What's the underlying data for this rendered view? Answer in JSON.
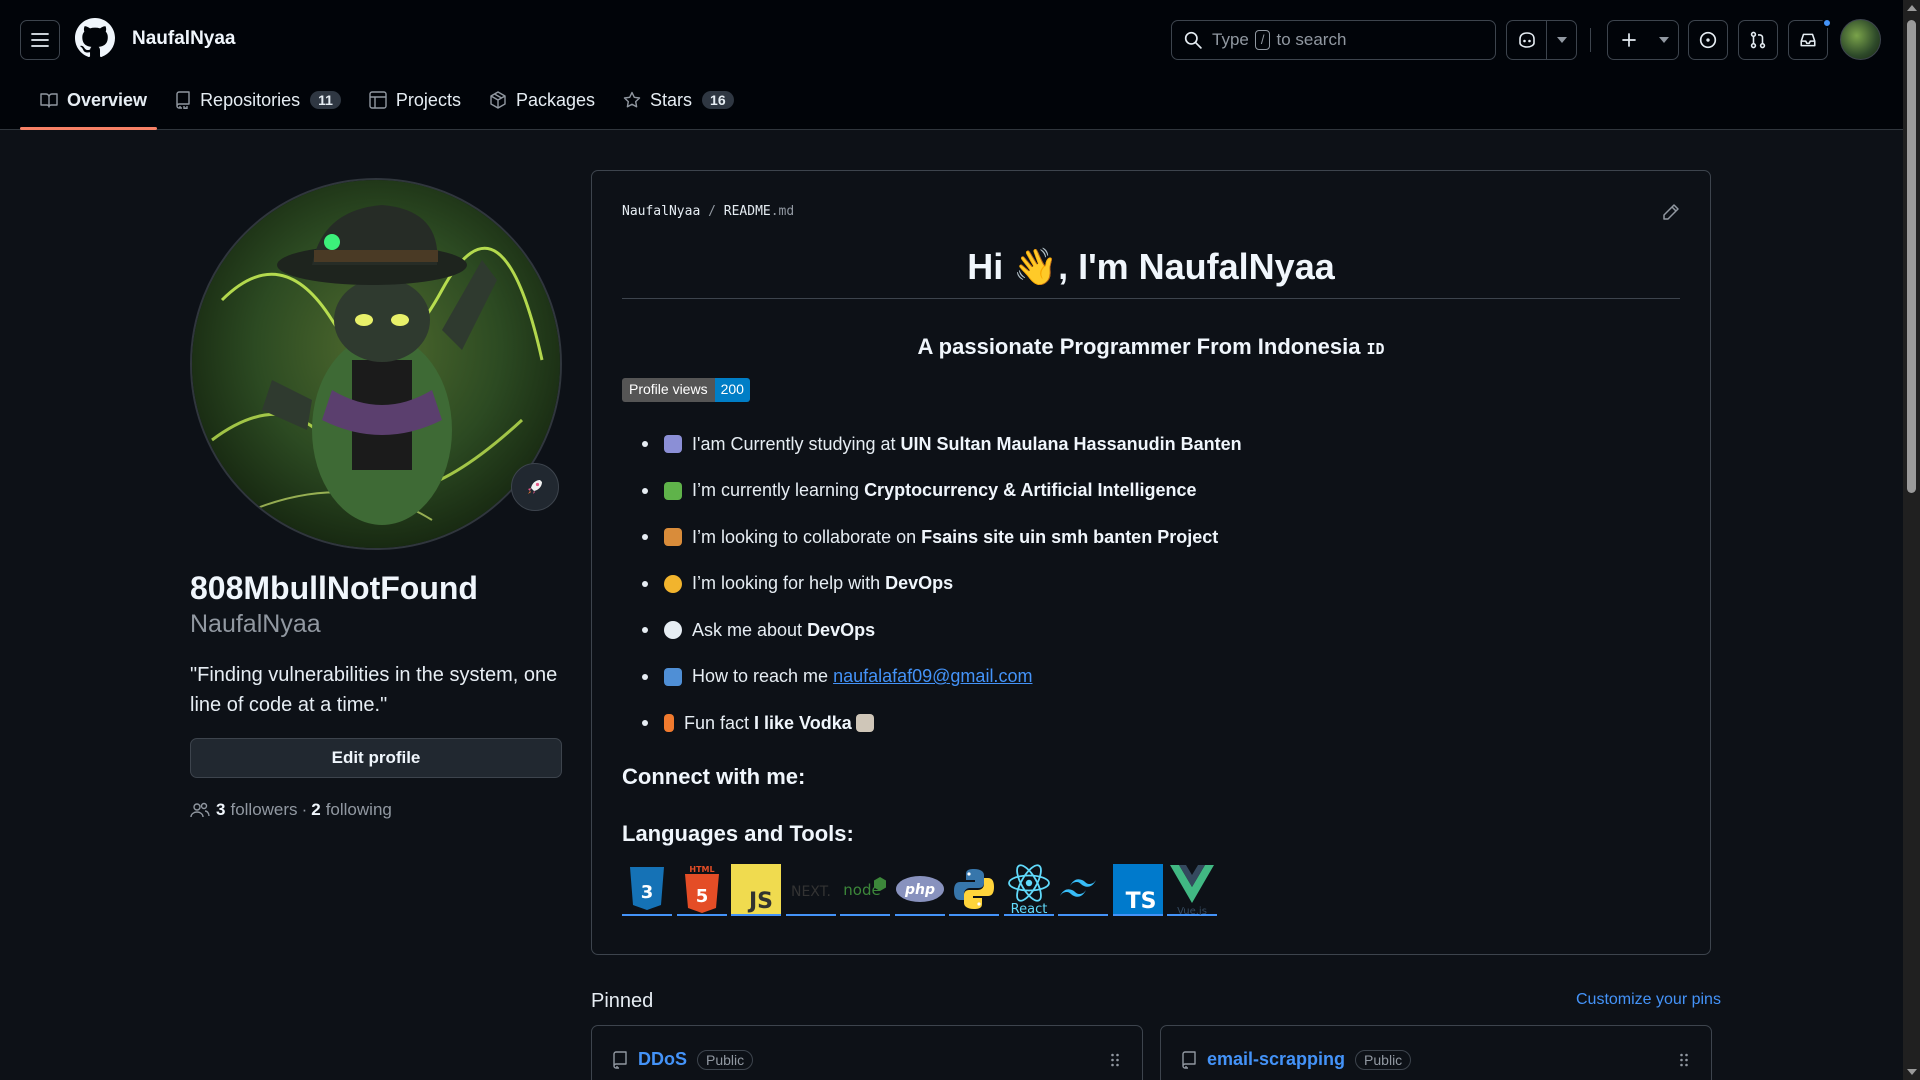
{
  "header": {
    "username": "NaufalNyaa",
    "search_prefix": "Type",
    "search_key": "/",
    "search_suffix": "to search"
  },
  "tabs": [
    {
      "label": "Overview",
      "icon": "book-icon"
    },
    {
      "label": "Repositories",
      "count": "11",
      "icon": "repo-icon"
    },
    {
      "label": "Projects",
      "icon": "table-icon"
    },
    {
      "label": "Packages",
      "icon": "package-icon"
    },
    {
      "label": "Stars",
      "count": "16",
      "icon": "star-icon"
    }
  ],
  "profile": {
    "display_name": "808MbullNotFound",
    "login": "NaufalNyaa",
    "bio": "\"Finding vulnerabilities in the system, one line of code at a time.\"",
    "edit_label": "Edit profile",
    "followers_count": "3",
    "followers_label": "followers",
    "separator": "·",
    "following_count": "2",
    "following_label": "following"
  },
  "readme": {
    "path_user": "NaufalNyaa",
    "path_sep": "/",
    "path_file": "README",
    "path_ext": ".md",
    "title_pre": "Hi",
    "title_emoji": "👋",
    "title_post": ", I'm NaufalNyaa",
    "subtitle": "A passionate Programmer From Indonesia",
    "flag": "ID",
    "badge_label": "Profile views",
    "badge_value": "200",
    "items": [
      {
        "text": "I'am Currently studying at",
        "bold": "UIN Sultan Maulana Hassanudin Banten",
        "emoji_color": "#8b8fd6"
      },
      {
        "text": "I’m currently learning",
        "bold": "Cryptocurrency & Artificial Intelligence",
        "emoji_color": "#5fb34a"
      },
      {
        "text": "I’m looking to collaborate on",
        "bold": "Fsains site uin smh banten Project",
        "emoji_color": "#d98c3a"
      },
      {
        "text": "I’m looking for help with",
        "bold": "DevOps",
        "emoji_color": "#f2b42d"
      },
      {
        "text": "Ask me about",
        "bold": "DevOps",
        "emoji_color": "#e6edf3"
      },
      {
        "text": "How to reach me",
        "link": "naufalafaf09@gmail.com",
        "emoji_color": "#4f8fd6"
      },
      {
        "text": "Fun fact",
        "bold": "I like Vodka",
        "emoji_color": "#f07a2e"
      }
    ],
    "connect_heading": "Connect with me:",
    "tools_heading": "Languages and Tools:",
    "tools": [
      "CSS3",
      "HTML",
      "JS",
      "NEXT.",
      "node",
      "php",
      "Python",
      "React",
      "Tailwind",
      "TS",
      "Vue.js"
    ]
  },
  "pinned": {
    "title": "Pinned",
    "customize": "Customize your pins",
    "repos": [
      {
        "name": "DDoS",
        "visibility": "Public"
      },
      {
        "name": "email-scrapping",
        "visibility": "Public"
      }
    ]
  },
  "colors": {
    "bg": "#0d1117",
    "header_bg": "#010409",
    "link": "#4493f8",
    "tab_underline": "#f78166"
  }
}
